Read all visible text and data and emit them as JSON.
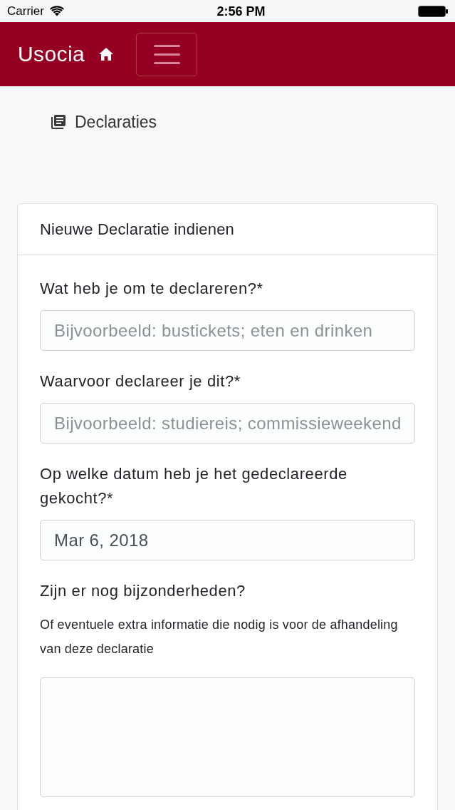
{
  "status_bar": {
    "carrier": "Carrier",
    "time": "2:56 PM"
  },
  "navbar": {
    "brand": "Usocia"
  },
  "breadcrumb": {
    "label": "Declaraties"
  },
  "card": {
    "title": "Nieuwe Declaratie indienen",
    "fields": [
      {
        "kind": "input",
        "label": "Wat heb je om te declareren?*",
        "placeholder": "Bijvoorbeeld: bustickets; eten en drinken"
      },
      {
        "kind": "input",
        "label": "Waarvoor declareer je dit?*",
        "placeholder": "Bijvoorbeeld: studiereis; commissieweekend"
      },
      {
        "kind": "input",
        "label": "Op welke datum heb je het gedeclareerde gekocht?*",
        "value": "Mar 6, 2018"
      },
      {
        "kind": "textarea",
        "label": "Zijn er nog bijzonderheden?",
        "help": "Of eventuele extra informatie die nodig is voor de afhandeling van deze declaratie"
      }
    ]
  }
}
